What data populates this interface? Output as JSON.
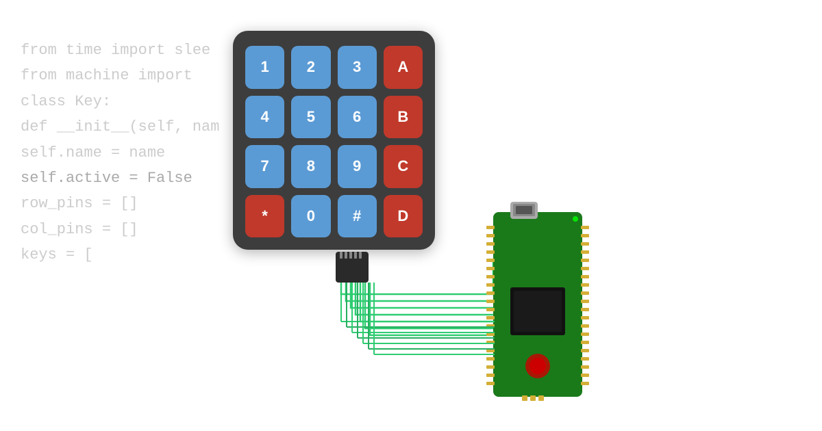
{
  "code": {
    "lines": [
      {
        "text": "from time import slee",
        "indent": 0,
        "blank": false
      },
      {
        "text": "from machine import",
        "indent": 0,
        "blank": false
      },
      {
        "text": "",
        "indent": 0,
        "blank": true
      },
      {
        "text": "class Key:",
        "indent": 0,
        "blank": false
      },
      {
        "text": "  def __init__(self, nam",
        "indent": 0,
        "blank": false
      },
      {
        "text": "    self.name = name",
        "indent": 0,
        "blank": false
      },
      {
        "text": "    self.active = False",
        "indent": 0,
        "blank": false
      },
      {
        "text": "",
        "indent": 0,
        "blank": true
      },
      {
        "text": "row_pins = []",
        "indent": 0,
        "blank": false
      },
      {
        "text": "col_pins = []",
        "indent": 0,
        "blank": false
      },
      {
        "text": "",
        "indent": 0,
        "blank": true
      },
      {
        "text": "keys = [",
        "indent": 0,
        "blank": false
      }
    ]
  },
  "keypad": {
    "keys": [
      {
        "label": "1",
        "type": "blue"
      },
      {
        "label": "2",
        "type": "blue"
      },
      {
        "label": "3",
        "type": "blue"
      },
      {
        "label": "A",
        "type": "red"
      },
      {
        "label": "4",
        "type": "blue"
      },
      {
        "label": "5",
        "type": "blue"
      },
      {
        "label": "6",
        "type": "blue"
      },
      {
        "label": "B",
        "type": "red"
      },
      {
        "label": "7",
        "type": "blue"
      },
      {
        "label": "8",
        "type": "blue"
      },
      {
        "label": "9",
        "type": "blue"
      },
      {
        "label": "C",
        "type": "red"
      },
      {
        "label": "*",
        "type": "red"
      },
      {
        "label": "0",
        "type": "blue"
      },
      {
        "label": "#",
        "type": "blue"
      },
      {
        "label": "D",
        "type": "red"
      }
    ]
  },
  "highlight": {
    "text": "self active"
  }
}
